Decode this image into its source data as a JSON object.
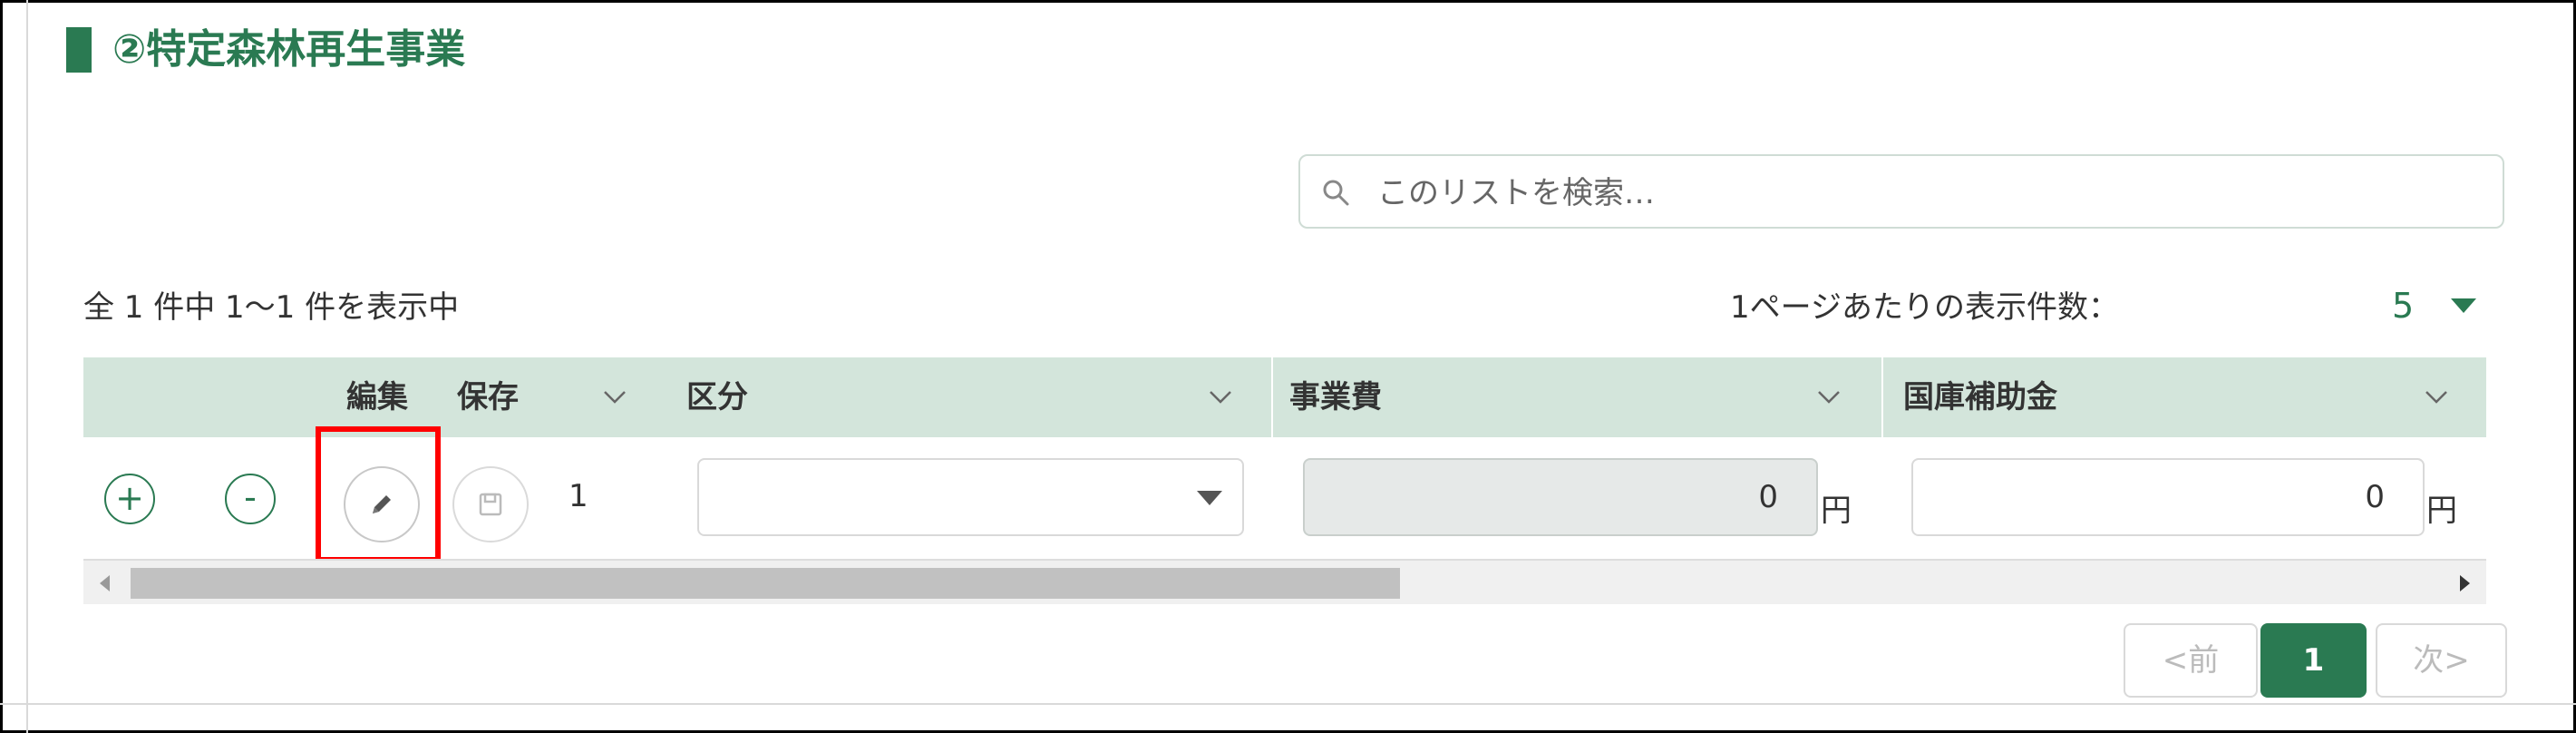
{
  "section": {
    "title": "②特定森林再生事業",
    "accent_color": "#2a7a52"
  },
  "search": {
    "placeholder": "このリストを検索…",
    "icon": "search-icon"
  },
  "summary": {
    "count_text": "全 1 件中 1～1 件を表示中"
  },
  "per_page": {
    "label": "1ページあたりの表示件数：",
    "value": "5"
  },
  "table": {
    "headers": {
      "edit": "編集",
      "save": "保存",
      "category": "区分",
      "project_cost": "事業費",
      "national_subsidy": "国庫補助金"
    },
    "rows": [
      {
        "add_icon": "+",
        "remove_icon": "-",
        "number": "1",
        "category": "",
        "project_cost": "0",
        "project_cost_unit": "円",
        "national_subsidy": "0",
        "national_subsidy_unit": "円"
      }
    ]
  },
  "pagination": {
    "prev": "<前",
    "current": "1",
    "next": "次>"
  },
  "colors": {
    "header_bg": "#d3e5db",
    "highlight": "#ff0000",
    "primary": "#2a7a52"
  }
}
